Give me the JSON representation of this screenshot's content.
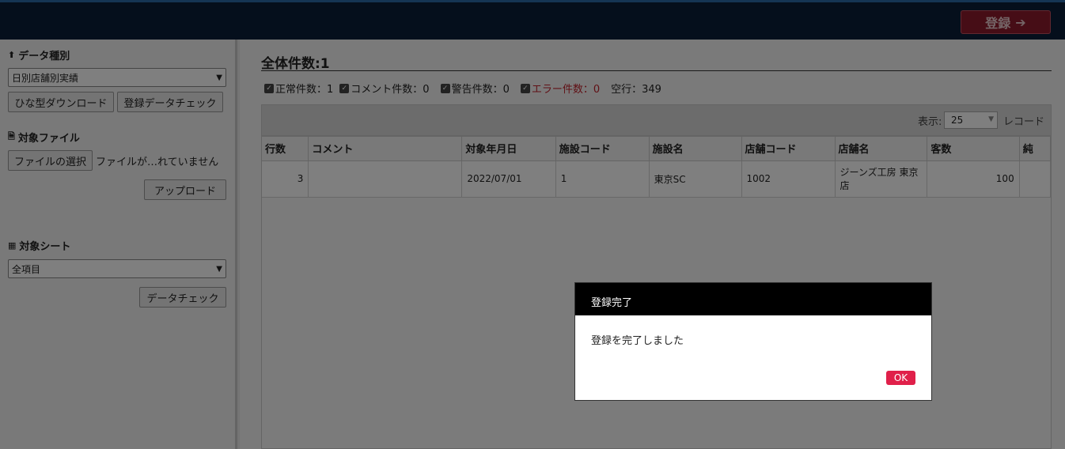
{
  "header": {
    "register_button": "登録",
    "arrow": "➔"
  },
  "sidebar": {
    "data_type_title": "データ種別",
    "data_type_value": "日別店舗別実績",
    "template_download": "ひな型ダウンロード",
    "register_data_check": "登録データチェック",
    "target_file_title": "対象ファイル",
    "file_select": "ファイルの選択",
    "file_name": "ファイルが…れていません",
    "upload": "アップロード",
    "target_sheet_title": "対象シート",
    "sheet_value": "全項目",
    "data_check": "データチェック"
  },
  "main": {
    "total": "全体件数:1",
    "counts": {
      "normal": "正常件数：1",
      "comment": "コメント件数：0",
      "warning": "警告件数：0",
      "error": "エラー件数：0",
      "empty": "空行：349"
    },
    "display_label": "表示:",
    "page_size": "25",
    "record_label": "レコード",
    "columns": [
      "行数",
      "コメント",
      "対象年月日",
      "施設コード",
      "施設名",
      "店舗コード",
      "店舗名",
      "客数",
      "純"
    ],
    "rows": [
      [
        "3",
        "",
        "2022/07/01",
        "1",
        "東京SC",
        "1002",
        "ジーンズ工房 東京店",
        "100",
        ""
      ]
    ]
  },
  "dialog": {
    "title": "登録完了",
    "message": "登録を完了しました",
    "ok": "OK"
  },
  "colors": {
    "header_bg": "#0a1e38",
    "error_text": "#c0202a",
    "ok_button": "#e0204a"
  }
}
